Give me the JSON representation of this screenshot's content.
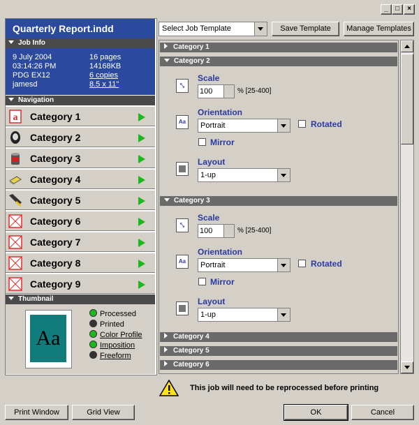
{
  "window": {
    "minimize": "_",
    "maximize": "□",
    "close": "×"
  },
  "document": {
    "title": "Quarterly Report.indd"
  },
  "job_info": {
    "header": "Job Info",
    "date": "9 July 2004",
    "time": "03:14:26 PM",
    "printer": "PDG EX12",
    "user": "jamesd",
    "pages": "16 pages",
    "size": "14168KB",
    "copies": "6 copies",
    "paper": "8.5 x 11\""
  },
  "navigation": {
    "header": "Navigation",
    "items": [
      {
        "label": "Category 1",
        "icon": "text-a-icon"
      },
      {
        "label": "Category 2",
        "icon": "toner-cartridge-icon"
      },
      {
        "label": "Category 3",
        "icon": "paint-can-icon"
      },
      {
        "label": "Category 4",
        "icon": "paper-stack-icon"
      },
      {
        "label": "Category 5",
        "icon": "stapler-icon"
      },
      {
        "label": "Category 6",
        "icon": "placeholder-x-icon"
      },
      {
        "label": "Category 7",
        "icon": "placeholder-x-icon"
      },
      {
        "label": "Category 8",
        "icon": "placeholder-x-icon"
      },
      {
        "label": "Category 9",
        "icon": "placeholder-x-icon"
      }
    ]
  },
  "thumbnail": {
    "header": "Thumbnail",
    "preview_text": "Aa",
    "statuses": [
      {
        "label": "Processed",
        "color": "#1db81d"
      },
      {
        "label": "Printed",
        "color": "#333333"
      },
      {
        "label": "Color Profile",
        "color": "#1db81d"
      },
      {
        "label": "Imposition",
        "color": "#1db81d"
      },
      {
        "label": "Freeform",
        "color": "#333333"
      }
    ]
  },
  "toolbar": {
    "template_select": "Select Job Template",
    "save_template": "Save Template",
    "manage_templates": "Manage Templates"
  },
  "categories": {
    "cat1": "Category 1",
    "cat2": "Category 2",
    "cat3": "Category 3",
    "cat4": "Category 4",
    "cat5": "Category 5",
    "cat6": "Category 6"
  },
  "fields": {
    "scale_label": "Scale",
    "scale_value": "100",
    "scale_range": "% [25-400]",
    "orientation_label": "Orientation",
    "orientation_value": "Portrait",
    "rotated_label": "Rotated",
    "mirror_label": "Mirror",
    "layout_label": "Layout",
    "layout_value": "1-up"
  },
  "warning": {
    "text": "This job will need to be reprocessed before printing"
  },
  "footer": {
    "print_window": "Print Window",
    "grid_view": "Grid View",
    "ok": "OK",
    "cancel": "Cancel"
  },
  "colors": {
    "accent": "#2b4a9e",
    "go": "#1db81d",
    "label": "#2b3aa0"
  }
}
